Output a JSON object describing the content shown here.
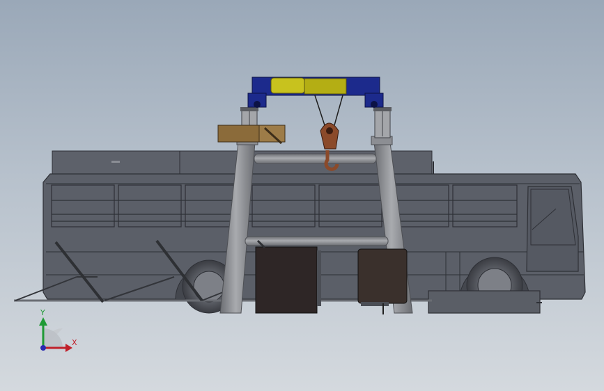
{
  "scene": {
    "background_top": "#9aa8b8",
    "background_bottom": "#d4d9de",
    "colors": {
      "bus_body": "#5b5f68",
      "bus_dark": "#3c3f46",
      "frame_tube": "#8d8e92",
      "trolley_blue": "#1c2a8c",
      "trolley_yellow": "#c8c21e",
      "hook": "#8b4a2a",
      "box_brown": "#8b6b3a",
      "box_dark": "#2e2626",
      "drum": "#3a302c"
    }
  },
  "triad": {
    "x_label": "X",
    "y_label": "Y",
    "x_color": "#c0202a",
    "y_color": "#1f9a35",
    "z_color": "#2a2ab0"
  }
}
